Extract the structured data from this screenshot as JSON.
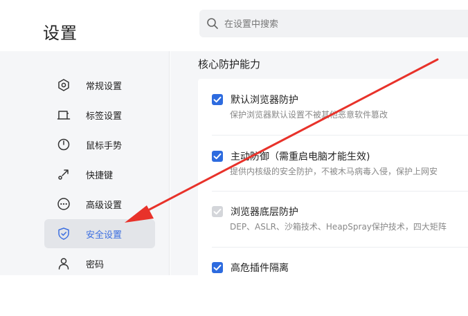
{
  "header": {
    "title": "设置",
    "search_placeholder": "在设置中搜索"
  },
  "sidebar": {
    "items": [
      {
        "label": "常规设置",
        "icon": "hexagon-settings-icon",
        "active": false
      },
      {
        "label": "标签设置",
        "icon": "tab-icon",
        "active": false
      },
      {
        "label": "鼠标手势",
        "icon": "mouse-icon",
        "active": false
      },
      {
        "label": "快捷键",
        "icon": "shortcut-arrow-icon",
        "active": false
      },
      {
        "label": "高级设置",
        "icon": "more-circle-icon",
        "active": false
      },
      {
        "label": "安全设置",
        "icon": "shield-icon",
        "active": true
      },
      {
        "label": "密码",
        "icon": "person-icon",
        "active": false
      }
    ]
  },
  "main": {
    "section_title": "核心防护能力",
    "options": [
      {
        "title": "默认浏览器防护",
        "desc": "保护浏览器默认设置不被其他恶意软件篡改",
        "checked": true,
        "disabled": false
      },
      {
        "title": "主动防御（需重启电脑才能生效)",
        "desc": "提供内核级的安全防护，不被木马病毒入侵，保护上网安",
        "checked": true,
        "disabled": false
      },
      {
        "title": "浏览器底层防护",
        "desc": "DEP、ASLR、沙箱技术、HeapSpray保护技术，四大矩阵",
        "checked": true,
        "disabled": true
      },
      {
        "title": "高危插件隔离",
        "desc": "",
        "checked": true,
        "disabled": false
      }
    ]
  },
  "colors": {
    "accent": "#2d6bdf",
    "active_text": "#3c6fe0",
    "arrow": "#e8322a",
    "sidebar_bg": "#f5f6f8"
  }
}
